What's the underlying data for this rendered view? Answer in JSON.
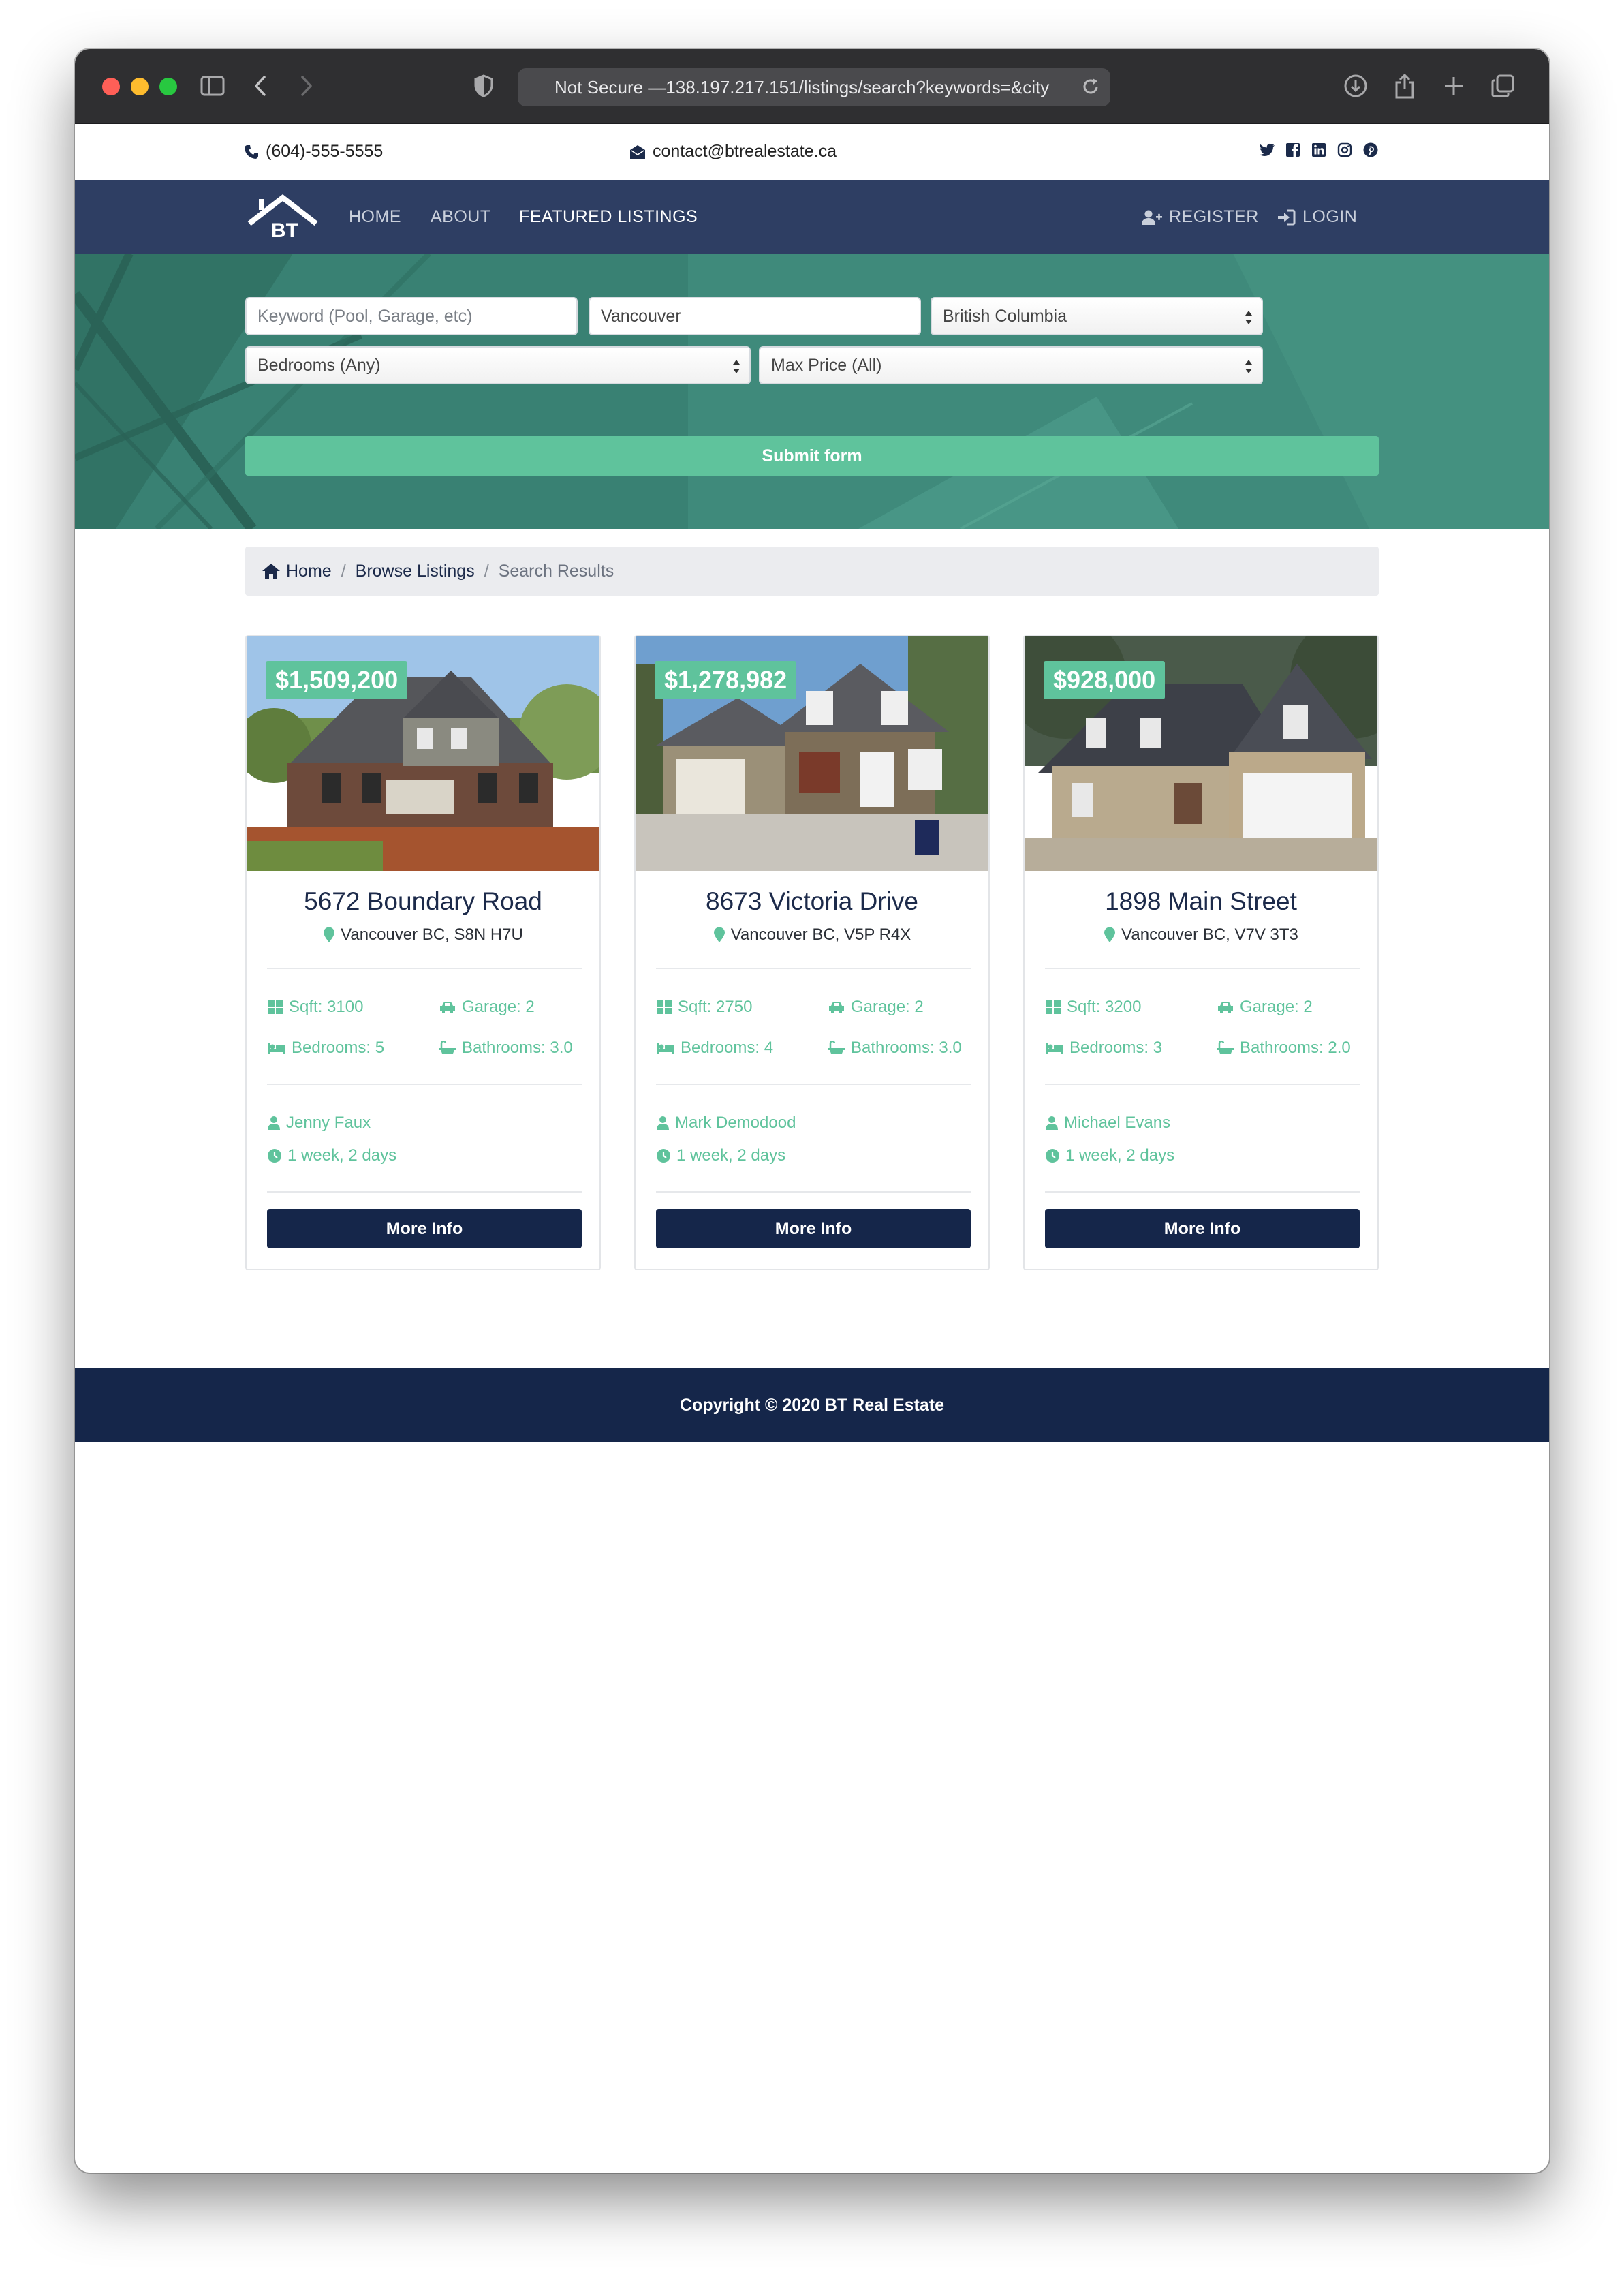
{
  "browser": {
    "url_prefix": "Not Secure — ",
    "url": "138.197.217.151/listings/search?keywords=&city"
  },
  "topbar": {
    "phone": "(604)-555-5555",
    "email": "contact@btrealestate.ca",
    "social_icons": [
      "twitter-icon",
      "facebook-icon",
      "linkedin-icon",
      "instagram-icon",
      "pinterest-icon"
    ]
  },
  "nav": {
    "logo_text": "BT",
    "links": [
      "HOME",
      "ABOUT",
      "FEATURED LISTINGS"
    ],
    "register": "REGISTER",
    "login": "LOGIN"
  },
  "search": {
    "keyword_placeholder": "Keyword (Pool, Garage, etc)",
    "city_value": "Vancouver",
    "province_value": "British Columbia",
    "bedrooms_value": "Bedrooms (Any)",
    "max_price_value": "Max Price (All)",
    "submit_label": "Submit form"
  },
  "breadcrumb": {
    "home": "Home",
    "browse": "Browse Listings",
    "current": "Search Results",
    "separator": "/"
  },
  "listings": [
    {
      "price": "$1,509,200",
      "title": "5672 Boundary Road",
      "address": "Vancouver BC, S8N H7U",
      "sqft": "Sqft: 3100",
      "garage": "Garage: 2",
      "bedrooms": "Bedrooms: 5",
      "bathrooms": "Bathrooms: 3.0",
      "realtor": "Jenny Faux",
      "listed": "1 week, 2 days",
      "button": "More Info"
    },
    {
      "price": "$1,278,982",
      "title": "8673 Victoria Drive",
      "address": "Vancouver BC, V5P R4X",
      "sqft": "Sqft: 2750",
      "garage": "Garage: 2",
      "bedrooms": "Bedrooms: 4",
      "bathrooms": "Bathrooms: 3.0",
      "realtor": "Mark Demodood",
      "listed": "1 week, 2 days",
      "button": "More Info"
    },
    {
      "price": "$928,000",
      "title": "1898 Main Street",
      "address": "Vancouver BC, V7V 3T3",
      "sqft": "Sqft: 3200",
      "garage": "Garage: 2",
      "bedrooms": "Bedrooms: 3",
      "bathrooms": "Bathrooms: 2.0",
      "realtor": "Michael Evans",
      "listed": "1 week, 2 days",
      "button": "More Info"
    }
  ],
  "footer": {
    "copyright": "Copyright © 2020 BT Real Estate"
  },
  "colors": {
    "navy": "#15264a",
    "nav_bg": "#2e3e63",
    "accent_green": "#5fc39c",
    "hero_teal": "#3f8a7b"
  }
}
